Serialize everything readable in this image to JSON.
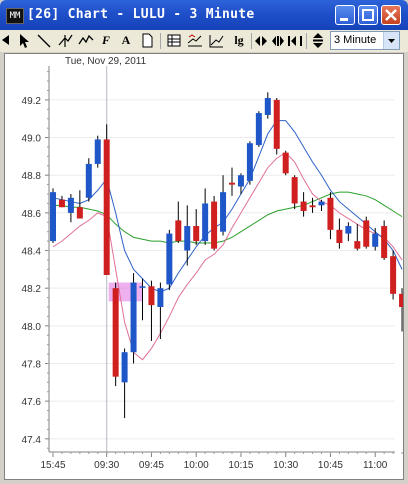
{
  "window": {
    "icon_text": "MM",
    "title": "[26]  Chart - LULU - 3 Minute"
  },
  "toolbar": {
    "tools": [
      "arrow-tool",
      "pointer-tool",
      "line-tool",
      "crosshair-tool",
      "zigzag-tool",
      "fibonacci-tool",
      "text-tool",
      "page-tool",
      "table-tool",
      "indicator-tool",
      "trend-tool",
      "log-scale-tool",
      "scroll-left-tool",
      "bars-tool",
      "zoom-tool",
      "updown-tool"
    ],
    "letters": {
      "fib": "F",
      "text": "A",
      "log": "lg"
    },
    "interval": "3 Minute"
  },
  "chart_data": {
    "type": "candlestick",
    "date_label": "Tue, Nov 29, 2011",
    "x_tick_labels": [
      "15:45",
      "09:30",
      "09:45",
      "10:00",
      "10:15",
      "10:30",
      "10:45",
      "11:00"
    ],
    "y_tick_labels": [
      "49.2",
      "49.0",
      "48.8",
      "48.6",
      "48.4",
      "48.2",
      "48.0",
      "47.8",
      "47.6",
      "47.4"
    ],
    "ylim": [
      47.33,
      49.38
    ],
    "colors": {
      "up": "#1f57c8",
      "down": "#d01f1f",
      "ma_fast": "#2f62c8",
      "ma_mid": "#e0709a",
      "ma_slow": "#2ba02b",
      "highlight": "#e070e0"
    },
    "candles": [
      {
        "o": 48.45,
        "h": 48.73,
        "l": 48.44,
        "c": 48.71
      },
      {
        "o": 48.67,
        "h": 48.69,
        "l": 48.63,
        "c": 48.63
      },
      {
        "o": 48.6,
        "h": 48.7,
        "l": 48.55,
        "c": 48.68
      },
      {
        "o": 48.63,
        "h": 48.72,
        "l": 48.57,
        "c": 48.57
      },
      {
        "o": 48.68,
        "h": 48.89,
        "l": 48.66,
        "c": 48.86
      },
      {
        "o": 48.86,
        "h": 49.01,
        "l": 48.84,
        "c": 48.99
      },
      {
        "o": 48.99,
        "h": 49.07,
        "l": 48.28,
        "c": 48.27
      },
      {
        "o": 48.2,
        "h": 48.23,
        "l": 47.68,
        "c": 47.73
      },
      {
        "o": 47.7,
        "h": 47.88,
        "l": 47.51,
        "c": 47.86
      },
      {
        "o": 47.86,
        "h": 48.28,
        "l": 47.8,
        "c": 48.23
      },
      {
        "o": 48.21,
        "h": 48.25,
        "l": 48.03,
        "c": 48.21
      },
      {
        "o": 48.21,
        "h": 48.24,
        "l": 47.92,
        "c": 48.11
      },
      {
        "o": 48.1,
        "h": 48.23,
        "l": 47.93,
        "c": 48.2
      },
      {
        "o": 48.22,
        "h": 48.51,
        "l": 48.19,
        "c": 48.49
      },
      {
        "o": 48.56,
        "h": 48.66,
        "l": 48.44,
        "c": 48.45
      },
      {
        "o": 48.4,
        "h": 48.64,
        "l": 48.32,
        "c": 48.53
      },
      {
        "o": 48.53,
        "h": 48.62,
        "l": 48.43,
        "c": 48.45
      },
      {
        "o": 48.45,
        "h": 48.73,
        "l": 48.43,
        "c": 48.65
      },
      {
        "o": 48.66,
        "h": 48.69,
        "l": 48.4,
        "c": 48.41
      },
      {
        "o": 48.5,
        "h": 48.8,
        "l": 48.48,
        "c": 48.71
      },
      {
        "o": 48.76,
        "h": 48.84,
        "l": 48.69,
        "c": 48.75
      },
      {
        "o": 48.74,
        "h": 48.81,
        "l": 48.7,
        "c": 48.8
      },
      {
        "o": 48.77,
        "h": 48.98,
        "l": 48.75,
        "c": 48.97
      },
      {
        "o": 48.96,
        "h": 49.14,
        "l": 48.95,
        "c": 49.13
      },
      {
        "o": 49.12,
        "h": 49.24,
        "l": 49.1,
        "c": 49.21
      },
      {
        "o": 49.2,
        "h": 49.21,
        "l": 48.91,
        "c": 48.94
      },
      {
        "o": 48.92,
        "h": 48.93,
        "l": 48.8,
        "c": 48.81
      },
      {
        "o": 48.79,
        "h": 48.8,
        "l": 48.62,
        "c": 48.65
      },
      {
        "o": 48.66,
        "h": 48.71,
        "l": 48.58,
        "c": 48.61
      },
      {
        "o": 48.64,
        "h": 48.68,
        "l": 48.6,
        "c": 48.63
      },
      {
        "o": 48.64,
        "h": 48.67,
        "l": 48.61,
        "c": 48.66
      },
      {
        "o": 48.68,
        "h": 48.71,
        "l": 48.46,
        "c": 48.51
      },
      {
        "o": 48.51,
        "h": 48.57,
        "l": 48.41,
        "c": 48.44
      },
      {
        "o": 48.49,
        "h": 48.55,
        "l": 48.45,
        "c": 48.53
      },
      {
        "o": 48.45,
        "h": 48.54,
        "l": 48.4,
        "c": 48.41
      },
      {
        "o": 48.56,
        "h": 48.58,
        "l": 48.41,
        "c": 48.42
      },
      {
        "o": 48.42,
        "h": 48.52,
        "l": 48.4,
        "c": 48.49
      },
      {
        "o": 48.53,
        "h": 48.56,
        "l": 48.35,
        "c": 48.36
      },
      {
        "o": 48.37,
        "h": 48.4,
        "l": 48.14,
        "c": 48.17
      },
      {
        "o": 48.17,
        "h": 48.2,
        "l": 47.97,
        "c": 48.1
      }
    ],
    "ma_fast": [
      48.68,
      48.67,
      48.66,
      48.65,
      48.67,
      48.72,
      48.78,
      48.6,
      48.4,
      48.3,
      48.25,
      48.2,
      48.18,
      48.2,
      48.28,
      48.35,
      48.42,
      48.48,
      48.52,
      48.55,
      48.62,
      48.7,
      48.78,
      48.9,
      49.02,
      49.09,
      49.09,
      49.03,
      48.95,
      48.87,
      48.8,
      48.72,
      48.66,
      48.62,
      48.58,
      48.54,
      48.5,
      48.46,
      48.4,
      48.3
    ],
    "ma_mid": [
      48.42,
      48.45,
      48.49,
      48.53,
      48.56,
      48.6,
      48.58,
      48.3,
      48.02,
      47.86,
      47.82,
      47.88,
      47.96,
      48.05,
      48.15,
      48.22,
      48.28,
      48.35,
      48.38,
      48.43,
      48.52,
      48.6,
      48.68,
      48.76,
      48.84,
      48.89,
      48.92,
      48.87,
      48.78,
      48.7,
      48.66,
      48.64,
      48.6,
      48.57,
      48.54,
      48.51,
      48.49,
      48.47,
      48.42,
      48.35
    ],
    "ma_slow": [
      48.64,
      48.64,
      48.63,
      48.63,
      48.62,
      48.61,
      48.59,
      48.54,
      48.5,
      48.47,
      48.46,
      48.45,
      48.45,
      48.44,
      48.45,
      48.45,
      48.44,
      48.44,
      48.44,
      48.45,
      48.47,
      48.5,
      48.53,
      48.56,
      48.59,
      48.61,
      48.62,
      48.63,
      48.64,
      48.66,
      48.68,
      48.7,
      48.71,
      48.71,
      48.7,
      48.69,
      48.67,
      48.64,
      48.61,
      48.58
    ]
  }
}
